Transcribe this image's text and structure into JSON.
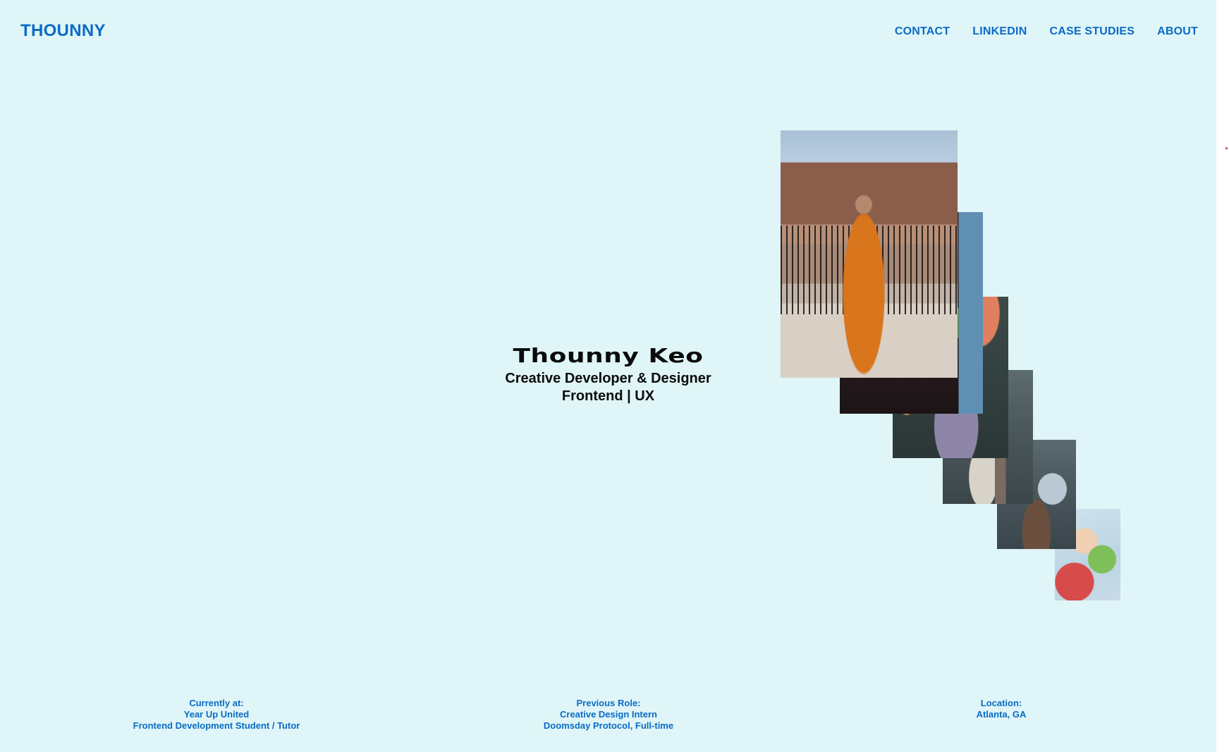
{
  "brand": {
    "label": "THOUNNY"
  },
  "nav": {
    "contact": "CONTACT",
    "linkedin": "LINKEDIN",
    "case_studies": "CASE STUDIES",
    "about": "ABOUT"
  },
  "hero": {
    "name": "Thounny Keo",
    "title": "Creative Developer & Designer",
    "specialty": "Frontend | UX"
  },
  "gallery": {
    "photos": [
      "monk-photo",
      "dark-portrait-photo",
      "night-street-photo",
      "building-photo",
      "flip-phone-photo",
      "fruit-photo"
    ]
  },
  "footer": {
    "current": {
      "heading": "Currently at:",
      "line1": "Year Up United",
      "line2": "Frontend Development Student / Tutor"
    },
    "previous": {
      "heading": "Previous Role:",
      "line1": "Creative Design Intern",
      "line2": "Doomsday Protocol, Full-time"
    },
    "location": {
      "heading": "Location:",
      "line1": "Atlanta, GA"
    }
  },
  "colors": {
    "background": "#dff5f7",
    "accent": "#0b6bc6",
    "text": "#0b0b0b"
  }
}
